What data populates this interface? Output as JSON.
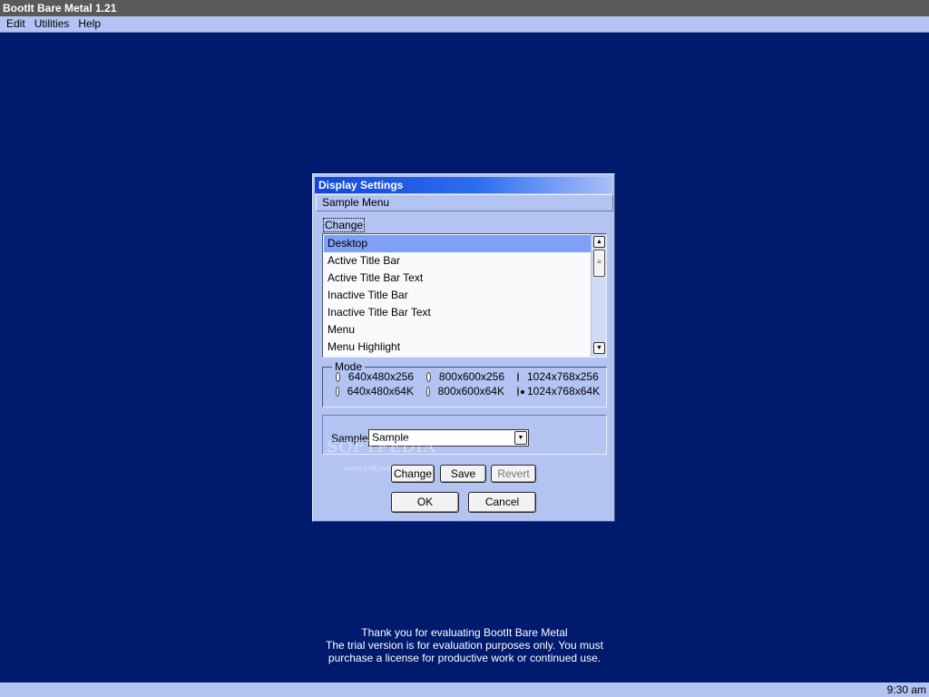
{
  "app": {
    "title": "BootIt Bare Metal 1.21"
  },
  "menubar": {
    "items": [
      "Edit",
      "Utilities",
      "Help"
    ]
  },
  "dialog": {
    "title": "Display Settings",
    "sample_menu": "Sample Menu",
    "change_label": "Change",
    "list": {
      "items": [
        "Desktop",
        "Active Title Bar",
        "Active Title Bar Text",
        "Inactive Title Bar",
        "Inactive Title Bar Text",
        "Menu",
        "Menu Highlight"
      ],
      "selected": "Desktop"
    },
    "mode": {
      "legend": "Mode",
      "options": [
        "640x480x256",
        "800x600x256",
        "1024x768x256",
        "640x480x64K",
        "800x600x64K",
        "1024x768x64K"
      ],
      "selected": "1024x768x64K"
    },
    "sample": {
      "label": "Sample",
      "value": "Sample"
    },
    "buttons": {
      "change": "Change",
      "save": "Save",
      "revert": "Revert",
      "ok": "OK",
      "cancel": "Cancel"
    },
    "watermark": {
      "brand": "SOFTPEDIA",
      "url": "www.softpedia.com"
    }
  },
  "trial_message": [
    "Thank you for evaluating BootIt Bare Metal",
    "The trial version is for evaluation purposes only.  You must",
    "purchase a license for productive work or continued use."
  ],
  "taskbar": {
    "clock": "9:30 am"
  },
  "colors": {
    "desktop": "#001a6e",
    "panel": "#b3c3f2",
    "selection": "#7ea0f5",
    "titlebar": "#1046d6"
  }
}
